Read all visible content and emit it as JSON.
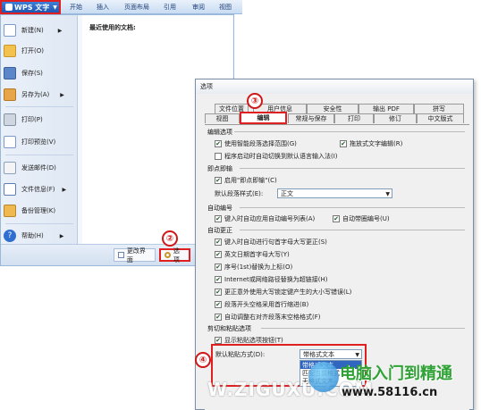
{
  "app": {
    "brand": "WPS 文字"
  },
  "ribbon": {
    "tabs": [
      "开始",
      "插入",
      "页面布局",
      "引用",
      "审阅",
      "视图"
    ]
  },
  "menu": {
    "items": [
      {
        "label": "新建(N)",
        "icon": "new-doc-icon"
      },
      {
        "label": "打开(O)",
        "icon": "open-folder-icon"
      },
      {
        "label": "保存(S)",
        "icon": "save-icon"
      },
      {
        "label": "另存为(A)",
        "icon": "save-as-icon"
      },
      {
        "label": "打印(P)",
        "icon": "print-icon"
      },
      {
        "label": "打印预览(V)",
        "icon": "print-preview-icon"
      },
      {
        "label": "发送邮件(D)",
        "icon": "mail-icon"
      },
      {
        "label": "文件信息(F)",
        "icon": "file-info-icon"
      },
      {
        "label": "备份管理(K)",
        "icon": "backup-icon"
      },
      {
        "label": "帮助(H)",
        "icon": "help-icon"
      }
    ],
    "recent_title": "最近使用的文档:",
    "change_ui_label": "更改界面",
    "options_label": "选项"
  },
  "markers": [
    "①",
    "②",
    "③",
    "④"
  ],
  "dialog": {
    "title": "选项",
    "tabs_row1": [
      "文件位置",
      "用户信息",
      "安全性",
      "输出 PDF",
      "拼写"
    ],
    "tabs_row2": [
      "视图",
      "编辑",
      "常规与保存",
      "打印",
      "修订",
      "中文版式"
    ],
    "sections": {
      "edit": "编辑选项",
      "clickinput": "即点即输",
      "numbering": "自动编号",
      "autocorrect": "自动更正",
      "cutpaste": "剪切和粘贴选项"
    },
    "edit_opts": [
      "使用智能段落选择范围(G)",
      "拖放式文字编辑(R)",
      "程序启动时自动切换到默认语言输入法(I)"
    ],
    "clickinput_opt": "启用\"即点即输\"(C)",
    "default_para_label": "默认段落样式(E):",
    "default_para_value": "正文",
    "numbering_opts": [
      "键入时自动应用自动编号列表(A)",
      "自动带圈编号(U)"
    ],
    "autocorrect_opts": [
      "键入时自动进行句首字母大写更正(S)",
      "英文日期首字母大写(Y)",
      "序号(1st)替换为上标(O)",
      "Internet或网络路径替换为超链接(H)",
      "更正意外使用大写锁定键产生的大小写错误(L)",
      "段落开头空格采用首行缩进(B)",
      "自动调整右对齐段落末空格格式(F)"
    ],
    "cutpaste_opt": "显示粘贴选项按钮(T)",
    "paste_label": "默认粘贴方式(D):",
    "paste_value": "带格式文本",
    "paste_options": [
      "带格式文本",
      "匹配当前格式",
      "无格式文本"
    ]
  },
  "watermark": {
    "brand": "电脑入门到精通",
    "url": "www.58116.cn",
    "left_text": "W.ZIGUXU.COM"
  }
}
